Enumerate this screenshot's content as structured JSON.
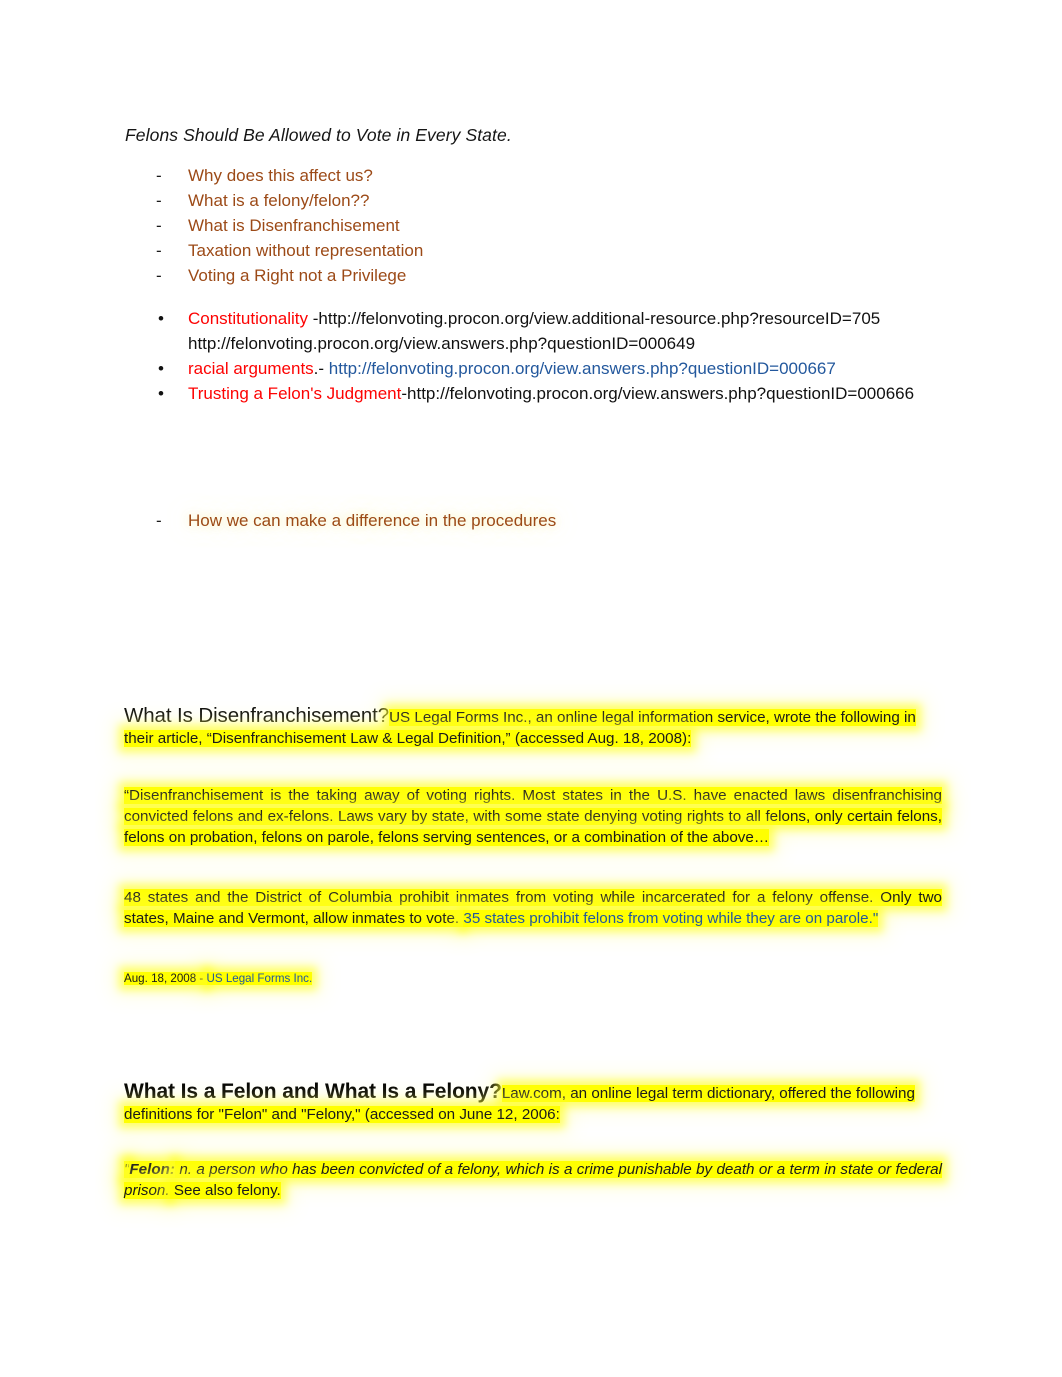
{
  "document": {
    "title": "Felons Should Be Allowed to Vote in Every State.",
    "outline": [
      {
        "marker": "-",
        "text": "Why does this affect us?"
      },
      {
        "marker": "-",
        "text": "What is a felony/felon??"
      },
      {
        "marker": "-",
        "text": "What is Disenfranchisement"
      },
      {
        "marker": "-",
        "text": "Taxation without representation"
      },
      {
        "marker": "-",
        "text": "Voting a Right not a Privilege"
      }
    ],
    "resources": [
      {
        "label": "Constitutionality",
        "separator": " -",
        "url": "http://felonvoting.procon.org/view.additional-resource.php?resourceID=705",
        "extra_url": "http://felonvoting.procon.org/view.answers.php?questionID=000649"
      },
      {
        "label": "racial arguments",
        "separator": ".- ",
        "url": "http://felonvoting.procon.org/view.answers.php?questionID=000667"
      },
      {
        "label": "Trusting a Felon's Judgment",
        "separator": "-",
        "url": "http://felonvoting.procon.org/view.answers.php?questionID=000666"
      }
    ],
    "closing_outline": [
      {
        "marker": "-",
        "text": "How we can make a difference in the procedures"
      }
    ],
    "sections": [
      {
        "heading": "What Is Disenfranchisement?",
        "heading_style": "regular",
        "intro": "US Legal Forms Inc., an online legal information service, wrote the following in their article, “Disenfranchisement Law & Legal Definition,” (accessed Aug. 18, 2008):",
        "paragraphs": [
          {
            "text": "“Disenfranchisement is the taking away of voting rights. Most states in the U.S. have enacted laws disenfranchising convicted felons and ex-felons. Laws vary by state, with some state denying voting rights to all felons, only certain felons, felons on probation, felons on parole, felons serving sentences, or a combination of the above…"
          },
          {
            "text_dark": "48 states and the District of Columbia prohibit inmates from voting while incarcerated for a felony offense. Only two states, Maine and Vermont, allow inmates to vote. ",
            "text_blue": "35 states prohibit felons from voting while they are on parole.\""
          }
        ],
        "citation_date": "Aug. 18, 2008 - ",
        "citation_source": "US Legal Forms Inc."
      },
      {
        "heading": "What Is a Felon and What Is a Felony?",
        "heading_style": "bold",
        "intro": "Law.com, an online legal term dictionary, offered the following definitions for \"Felon\" and \"Felony,\" (accessed on June 12, 2006:",
        "definition": {
          "open_quote": "\"",
          "term": "Felon:",
          "body": " n. a person who has been convicted of a felony, which is a crime punishable by death or a term in state or federal prison.",
          "tail": " See also felony."
        }
      }
    ]
  },
  "colors": {
    "outline_brown": "#9c4a17",
    "link_red": "#fd0303",
    "link_blue": "#23589d",
    "highlight_yellow": "#ffff00",
    "body_text": "#1b1b1b"
  }
}
